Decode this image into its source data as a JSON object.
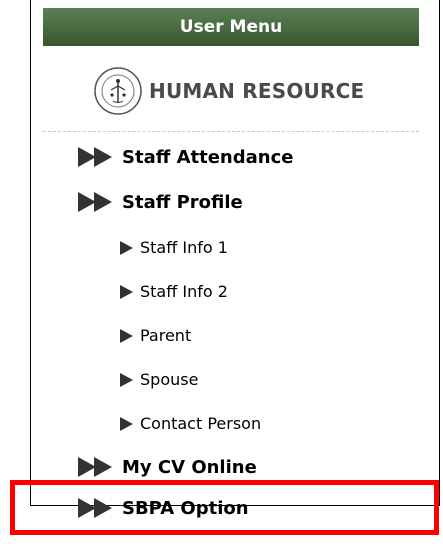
{
  "menu": {
    "header_title": "User Menu",
    "brand_text": "HUMAN RESOURCE",
    "logo_icon": "university-seal-icon",
    "items": [
      {
        "label": "Staff Attendance",
        "level": 1,
        "icon": "double-arrow-icon"
      },
      {
        "label": "Staff Profile",
        "level": 1,
        "icon": "double-arrow-icon"
      },
      {
        "label": "Staff Info 1",
        "level": 2,
        "icon": "arrow-icon"
      },
      {
        "label": "Staff Info 2",
        "level": 2,
        "icon": "arrow-icon"
      },
      {
        "label": "Parent",
        "level": 2,
        "icon": "arrow-icon"
      },
      {
        "label": "Spouse",
        "level": 2,
        "icon": "arrow-icon"
      },
      {
        "label": "Contact Person",
        "level": 2,
        "icon": "arrow-icon"
      },
      {
        "label": "My CV Online",
        "level": 1,
        "icon": "double-arrow-icon"
      },
      {
        "label": "SBPA Option",
        "level": 1,
        "icon": "double-arrow-icon"
      }
    ]
  },
  "colors": {
    "header_bg": "#4a6b42",
    "highlight_border": "#ff0000"
  }
}
